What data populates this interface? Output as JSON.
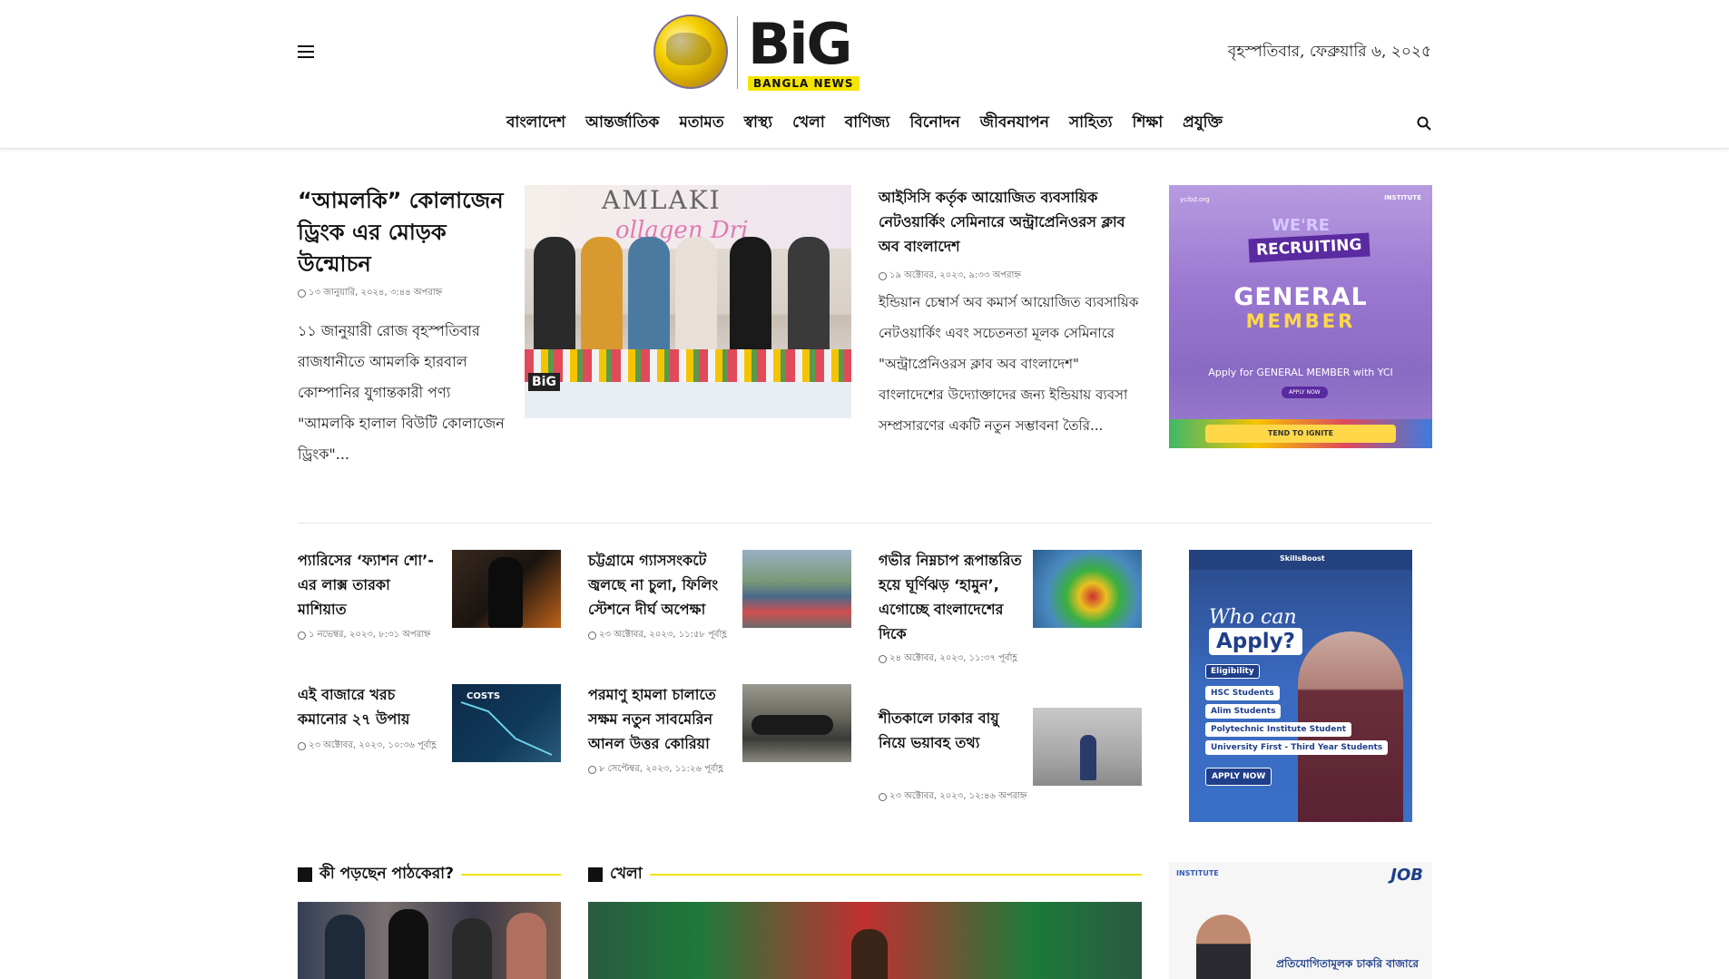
{
  "header": {
    "logo_text": "BiG",
    "logo_sub": "BANGLA NEWS",
    "date": "বৃহস্পতিবার, ফেব্রুয়ারি ৬, ২০২৫",
    "nav": [
      "বাংলাদেশ",
      "আন্তর্জাতিক",
      "মতামত",
      "স্বাস্থ্য",
      "খেলা",
      "বাণিজ্য",
      "বিনোদন",
      "জীবনযাপন",
      "সাহিত্য",
      "শিক্ষা",
      "প্রযুক্তি"
    ]
  },
  "lead": {
    "title": "“আমলকি” কোলাজেন ড্রিংক এর মোড়ক উন্মোচন",
    "date": "১৩ জানুয়ারি, ২০২৪, ৩:৪৪ অপরাহ্ন",
    "excerpt": "১১ জানুয়ারী রোজ বৃহস্পতিবার রাজধানীতে আমলকি হারবাল কোম্পানির যুগান্তকারী পণ্য \"আমলকি হালাল বিউটি কোলাজেন ড্রিংক\"...",
    "image_word": "AMLAKI",
    "image_sub": "ollagen Dri",
    "image_badge": "BiG"
  },
  "featured": {
    "title": "আইসিসি কর্তৃক আয়োজিত ব্যবসায়িক নেটওয়ার্কিং সেমিনারে অন্ট্রাপ্রেনিওরস ক্লাব অব বাংলাদেশ",
    "date": "১৯ অক্টোবর, ২০২৩, ৯:৩৩ অপরাহ্ন",
    "excerpt": "ইন্ডিয়ান চেম্বার্স অব কমার্স আয়োজিত ব্যবসায়িক নেটওয়ার্কিং এবং সচেতনতা মূলক সেমিনারে \"অন্ট্রাপ্রেনিওরস ক্লাব অব বাংলাদেশ\" বাংলাদেশের উদ্যোক্তাদের জন্য ইন্ডিয়ায় ব্যবসা সম্প্রসারণের একটি নতুন সম্ভাবনা তৈরি..."
  },
  "ad_general": {
    "label_tl": "ycibd.org",
    "label_tr": "INSTITUTE",
    "we_are": "WE'RE",
    "recruiting": "RECRUITING",
    "general": "GENERAL",
    "member": "MEMBER",
    "apply": "Apply for GENERAL MEMBER with YCI",
    "apply_btn": "APPLY NOW",
    "strip": "TEND TO IGNITE"
  },
  "grid": [
    {
      "title": "প্যারিসের ‘ফ্যাশন শো’-এর লাক্স তারকা মাশিয়াত",
      "date": "১ নভেম্বর, ২০২৩, ৮:৩১ অপরাহ্ন"
    },
    {
      "title": "চট্টগ্রামে গ্যাসসংকটে জ্বলছে না চুলা, ফিলিং স্টেশনে দীর্ঘ অপেক্ষা",
      "date": "২৩ অক্টোবর, ২০২৩, ১১:৫৮ পূর্বাহ্ণ"
    },
    {
      "title": "গভীর নিম্নচাপ রূপান্তরিত হয়ে ঘূর্ণিঝড় ‘হামুন’, এগোচ্ছে বাংলাদেশের দিকে",
      "date": "২৪ অক্টোবর, ২০২৩, ১১:৩৭ পূর্বাহ্ণ"
    },
    {
      "title": "এই বাজারে খরচ কমানোর ২৭ উপায়",
      "date": "২৩ অক্টোবর, ২০২৩, ১০:৩৬ পূর্বাহ্ণ",
      "img_label": "COSTS"
    },
    {
      "title": "পরমাণু হামলা চালাতে সক্ষম নতুন সাবমেরিন আনল উত্তর কোরিয়া",
      "date": "৮ সেপ্টেম্বর, ২০২৩, ১১:২৬ পূর্বাহ্ণ"
    },
    {
      "title": "শীতকালে ঢাকার বায়ু নিয়ে ভয়াবহ তথ্য",
      "date": "২৩ অক্টোবর, ২০২৩, ১২:৪৬ অপরাহ্ন"
    }
  ],
  "ad_apply": {
    "top": "SkillsBoost",
    "who": "Who can",
    "apply": "Apply?",
    "eligibility": "Eligibility",
    "options": [
      "HSC Students",
      "Alim Students",
      "Polytechnic Institute Student",
      "University First - Third Year Students"
    ],
    "apply_now": "APPLY NOW"
  },
  "sections": {
    "readers": "কী পড়ছেন পাঠকেরা?",
    "sports": "খেলা",
    "side_ad_left": "INSTITUTE",
    "side_ad_right": "JOB",
    "side_ad_text": "প্রতিযোগিতামূলক চাকরি বাজারে"
  }
}
